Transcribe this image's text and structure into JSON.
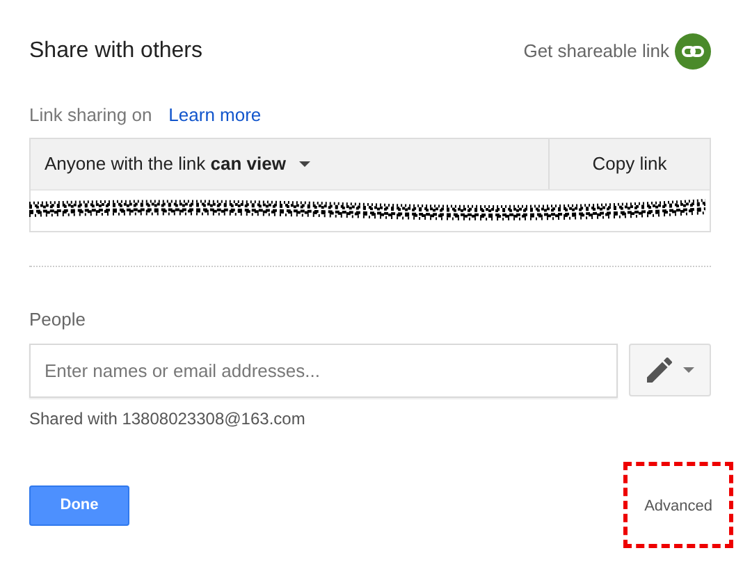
{
  "dialog": {
    "title": "Share with others",
    "get_link": "Get shareable link"
  },
  "link_sharing": {
    "status": "Link sharing on",
    "learn_more": "Learn more",
    "access": "Anyone with the link **can view**",
    "copy_button": "Copy link"
  },
  "people": {
    "label": "People",
    "input": {
      "placeholder": "Enter names or email addresses..."
    },
    "shared_with": "Shared with 13808023308@163.com"
  },
  "footer": {
    "done": "Done",
    "advanced": {
      "label": "Advanced",
      "highlighted": true
    }
  }
}
